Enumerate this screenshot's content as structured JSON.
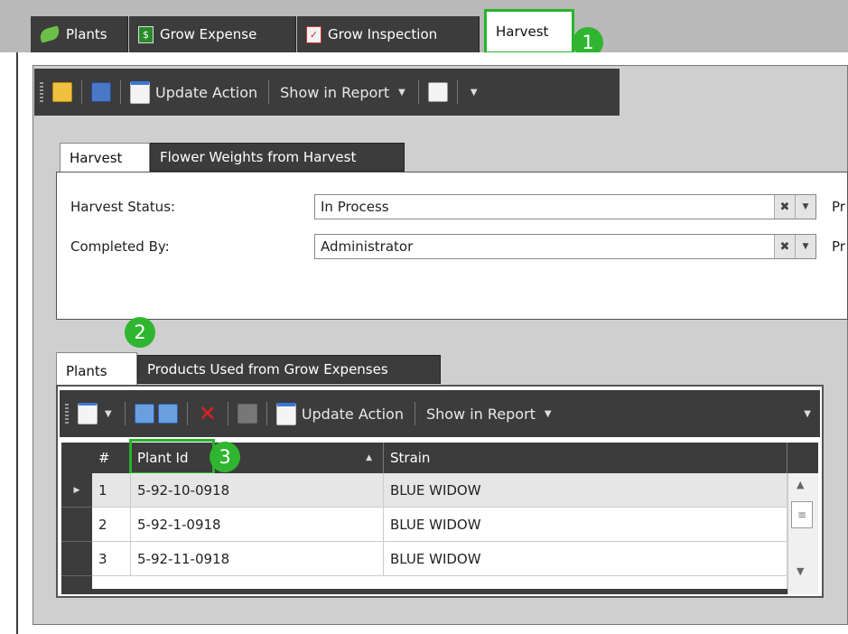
{
  "top_tabs": [
    {
      "label": "Plants",
      "icon": "leaf-icon"
    },
    {
      "label": "Grow Expense",
      "icon": "money-icon"
    },
    {
      "label": "Grow Inspection",
      "icon": "checklist-icon"
    },
    {
      "label": "Harvest",
      "icon": "",
      "active": true
    }
  ],
  "toolbar": {
    "update_action": "Update Action",
    "show_in_report": "Show in Report"
  },
  "detail_tabs": [
    {
      "label": "Harvest",
      "active": true
    },
    {
      "label": "Flower Weights from Harvest"
    }
  ],
  "form": {
    "harvest_status_label": "Harvest Status:",
    "harvest_status_value": "In Process",
    "completed_by_label": "Completed By:",
    "completed_by_value": "Administrator",
    "right_cut_1": "Pr",
    "right_cut_2": "Pr"
  },
  "sub_tabs": [
    {
      "label": "Plants",
      "active": true
    },
    {
      "label": "Products Used from Grow Expenses"
    }
  ],
  "grid_toolbar": {
    "update_action": "Update Action",
    "show_in_report": "Show in Report"
  },
  "grid": {
    "columns": [
      "#",
      "Plant Id",
      "Strain"
    ],
    "rows": [
      {
        "num": "1",
        "plant_id": "5-92-10-0918",
        "strain": "BLUE WIDOW"
      },
      {
        "num": "2",
        "plant_id": "5-92-1-0918",
        "strain": "BLUE WIDOW"
      },
      {
        "num": "3",
        "plant_id": "5-92-11-0918",
        "strain": "BLUE WIDOW"
      }
    ]
  },
  "callouts": [
    "1",
    "2",
    "3"
  ],
  "colors": {
    "highlight": "#28b428",
    "badge": "#2fb52f",
    "dark": "#3c3c3c"
  }
}
